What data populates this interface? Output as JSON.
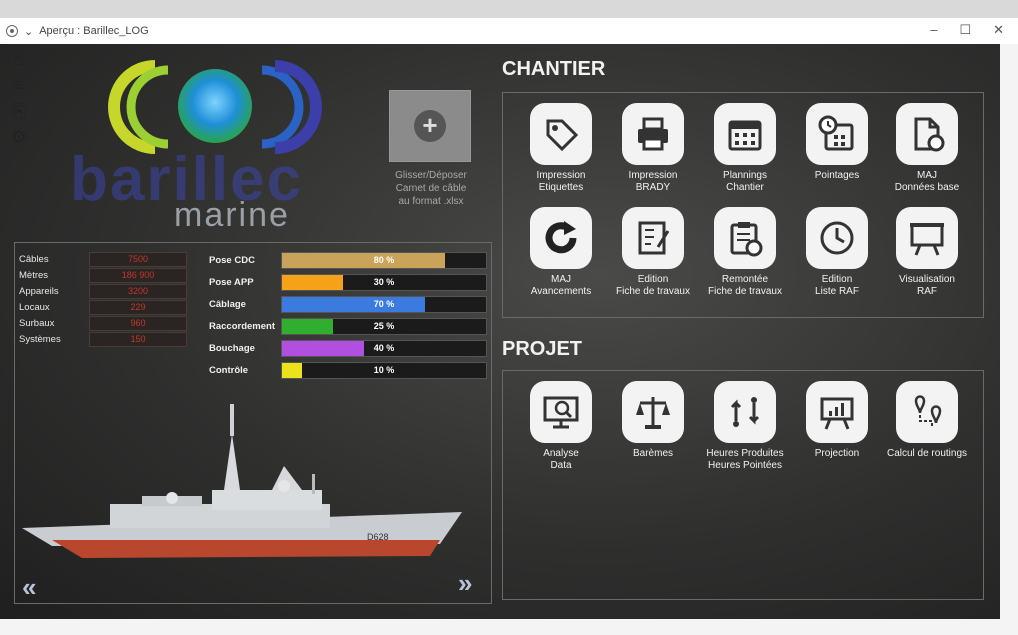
{
  "window": {
    "title": "Aperçu : Barillec_LOG"
  },
  "logo": {
    "brand": "barillec",
    "sub": "marine"
  },
  "dropzone": {
    "label_line1": "Glisser/Déposer",
    "label_line2": "Carnet de câble",
    "label_line3": "au format .xlsx"
  },
  "stats": [
    {
      "label": "Câbles",
      "value": "7500"
    },
    {
      "label": "Mètres",
      "value": "186 900"
    },
    {
      "label": "Appareils",
      "value": "3200"
    },
    {
      "label": "Locaux",
      "value": "229"
    },
    {
      "label": "Surbaux",
      "value": "960"
    },
    {
      "label": "Systèmes",
      "value": "150"
    }
  ],
  "progress": [
    {
      "label": "Pose CDC",
      "value": 80,
      "text": "80 %",
      "color": "#c9a35a"
    },
    {
      "label": "Pose APP",
      "value": 30,
      "text": "30 %",
      "color": "#f5a21a"
    },
    {
      "label": "Câblage",
      "value": 70,
      "text": "70 %",
      "color": "#3b7be0"
    },
    {
      "label": "Raccordement",
      "value": 25,
      "text": "25 %",
      "color": "#2fae2f"
    },
    {
      "label": "Bouchage",
      "value": 40,
      "text": "40 %",
      "color": "#b04fe0"
    },
    {
      "label": "Contrôle",
      "value": 10,
      "text": "10 %",
      "color": "#ece21c"
    }
  ],
  "ship": {
    "hull_number": "D628"
  },
  "nav": {
    "prev": "«",
    "next": "»"
  },
  "chantier": {
    "title": "CHANTIER",
    "tiles": [
      {
        "icon": "tag-icon",
        "l1": "Impression",
        "l2": "Etiquettes"
      },
      {
        "icon": "printer-icon",
        "l1": "Impression",
        "l2": "BRADY"
      },
      {
        "icon": "calendar-icon",
        "l1": "Plannings",
        "l2": "Chantier"
      },
      {
        "icon": "calendar-clock-icon",
        "l1": "Pointages",
        "l2": ""
      },
      {
        "icon": "file-refresh-icon",
        "l1": "MAJ",
        "l2": "Données base"
      },
      {
        "icon": "refresh-icon",
        "l1": "MAJ",
        "l2": "Avancements"
      },
      {
        "icon": "form-edit-icon",
        "l1": "Edition",
        "l2": "Fiche de travaux"
      },
      {
        "icon": "clipboard-check-icon",
        "l1": "Remontée",
        "l2": "Fiche de travaux"
      },
      {
        "icon": "clock-icon",
        "l1": "Edition",
        "l2": "Liste RAF"
      },
      {
        "icon": "presentation-icon",
        "l1": "Visualisation",
        "l2": "RAF"
      }
    ]
  },
  "projet": {
    "title": "PROJET",
    "tiles": [
      {
        "icon": "data-analysis-icon",
        "l1": "Analyse",
        "l2": "Data"
      },
      {
        "icon": "scale-icon",
        "l1": "Barèmes",
        "l2": ""
      },
      {
        "icon": "swap-icon",
        "l1": "Heures Produites",
        "l2": "Heures Pointées"
      },
      {
        "icon": "projection-icon",
        "l1": "Projection",
        "l2": ""
      },
      {
        "icon": "route-icon",
        "l1": "Calcul de routings",
        "l2": ""
      }
    ]
  },
  "colors": {
    "accent_bg": "#2f2f2e",
    "tile_bg": "#f3f3f3",
    "stat_value": "#c0392b"
  }
}
